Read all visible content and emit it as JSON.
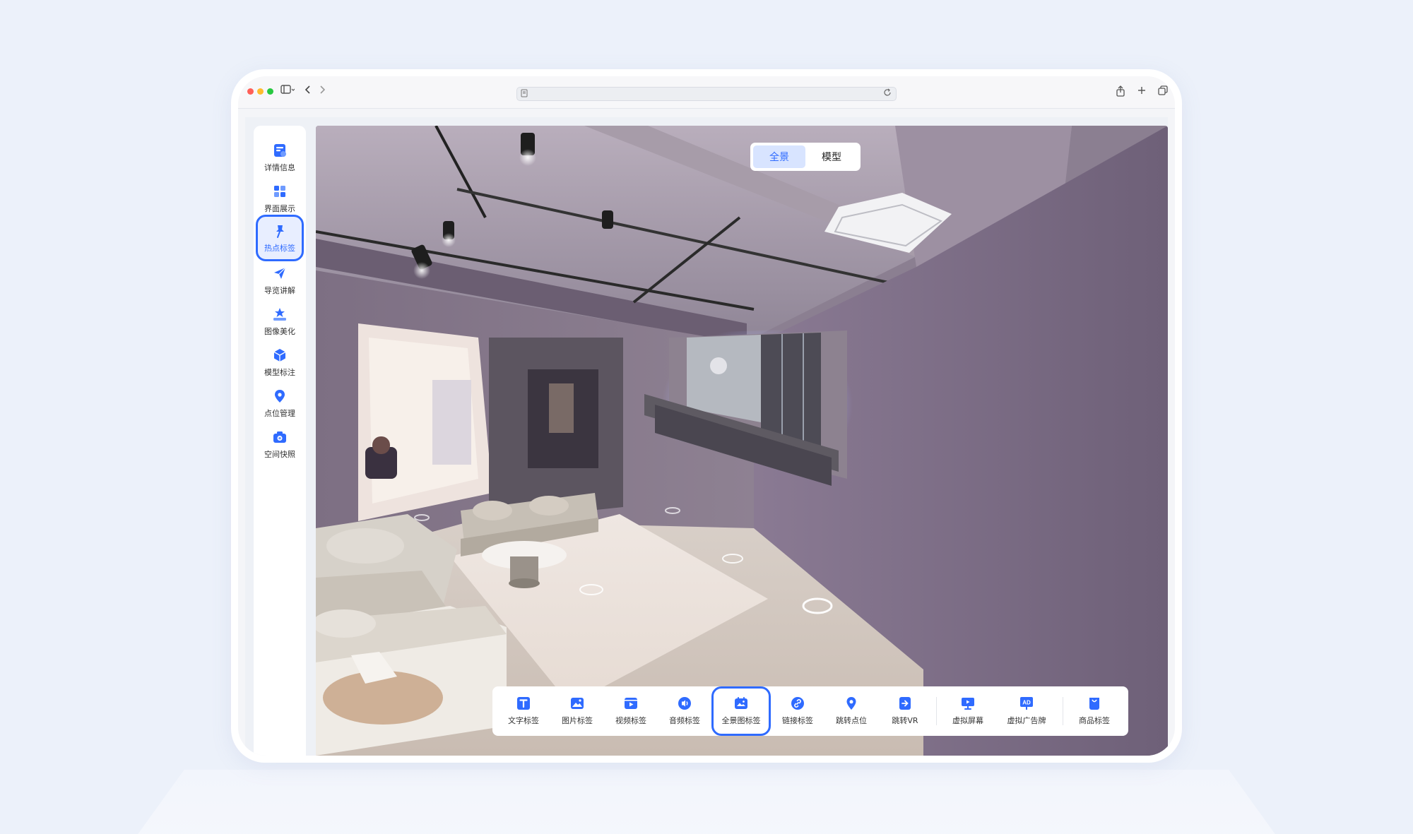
{
  "sidebar": {
    "items": [
      {
        "label": "详情信息",
        "icon": "document-icon"
      },
      {
        "label": "界面展示",
        "icon": "layout-icon"
      },
      {
        "label": "热点标签",
        "icon": "pin-icon",
        "active": true
      },
      {
        "label": "导览讲解",
        "icon": "send-icon"
      },
      {
        "label": "图像美化",
        "icon": "star-tray-icon"
      },
      {
        "label": "模型标注",
        "icon": "cube-icon"
      },
      {
        "label": "点位管理",
        "icon": "location-icon"
      },
      {
        "label": "空间快照",
        "icon": "camera-icon"
      }
    ]
  },
  "view_toggle": {
    "panorama": "全景",
    "model": "模型"
  },
  "tools": [
    {
      "label": "文字标签",
      "icon": "text-icon"
    },
    {
      "label": "图片标签",
      "icon": "image-icon"
    },
    {
      "label": "视频标签",
      "icon": "video-icon"
    },
    {
      "label": "音频标签",
      "icon": "audio-icon"
    },
    {
      "label": "全景图标签",
      "icon": "panorama-icon"
    },
    {
      "label": "链接标签",
      "icon": "link-icon"
    },
    {
      "label": "跳转点位",
      "icon": "location-icon"
    },
    {
      "label": "跳转VR",
      "icon": "jump-vr-icon"
    },
    {
      "label": "虚拟屏幕",
      "icon": "monitor-icon"
    },
    {
      "label": "虚拟广告牌",
      "icon": "ad-icon"
    },
    {
      "label": "商品标签",
      "icon": "shopping-bag-icon"
    }
  ],
  "colors": {
    "accent": "#2f6bff",
    "background": "#ecf1fa"
  }
}
